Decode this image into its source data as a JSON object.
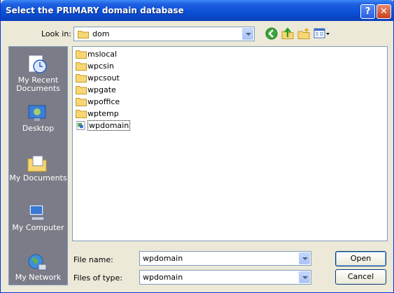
{
  "window": {
    "title": "Select the PRIMARY domain database",
    "help_glyph": "?",
    "close_glyph": "✕"
  },
  "lookin": {
    "label": "Look in:",
    "value": "dom"
  },
  "toolbar": {
    "icons": [
      "back-icon",
      "up-folder-icon",
      "new-folder-icon",
      "views-menu-icon"
    ]
  },
  "places": [
    {
      "label": "My Recent Documents",
      "icon": "recent-documents-icon"
    },
    {
      "label": "Desktop",
      "icon": "desktop-icon"
    },
    {
      "label": "My Documents",
      "icon": "my-documents-icon"
    },
    {
      "label": "My Computer",
      "icon": "my-computer-icon"
    },
    {
      "label": "My Network",
      "icon": "my-network-icon"
    }
  ],
  "files": [
    {
      "name": "mslocal",
      "kind": "folder"
    },
    {
      "name": "wpcsin",
      "kind": "folder"
    },
    {
      "name": "wpcsout",
      "kind": "folder"
    },
    {
      "name": "wpgate",
      "kind": "folder"
    },
    {
      "name": "wpoffice",
      "kind": "folder"
    },
    {
      "name": "wptemp",
      "kind": "folder"
    },
    {
      "name": "wpdomain",
      "kind": "database"
    }
  ],
  "filename": {
    "label": "File name:",
    "value": "wpdomain"
  },
  "filetype": {
    "label": "Files of type:",
    "value": "wpdomain"
  },
  "buttons": {
    "open": "Open",
    "cancel": "Cancel"
  },
  "colors": {
    "titlebar": "#0a4fd6",
    "dialog_bg": "#ece9d8",
    "places_bg": "#7c7c88",
    "folder": "#f2c94c"
  }
}
